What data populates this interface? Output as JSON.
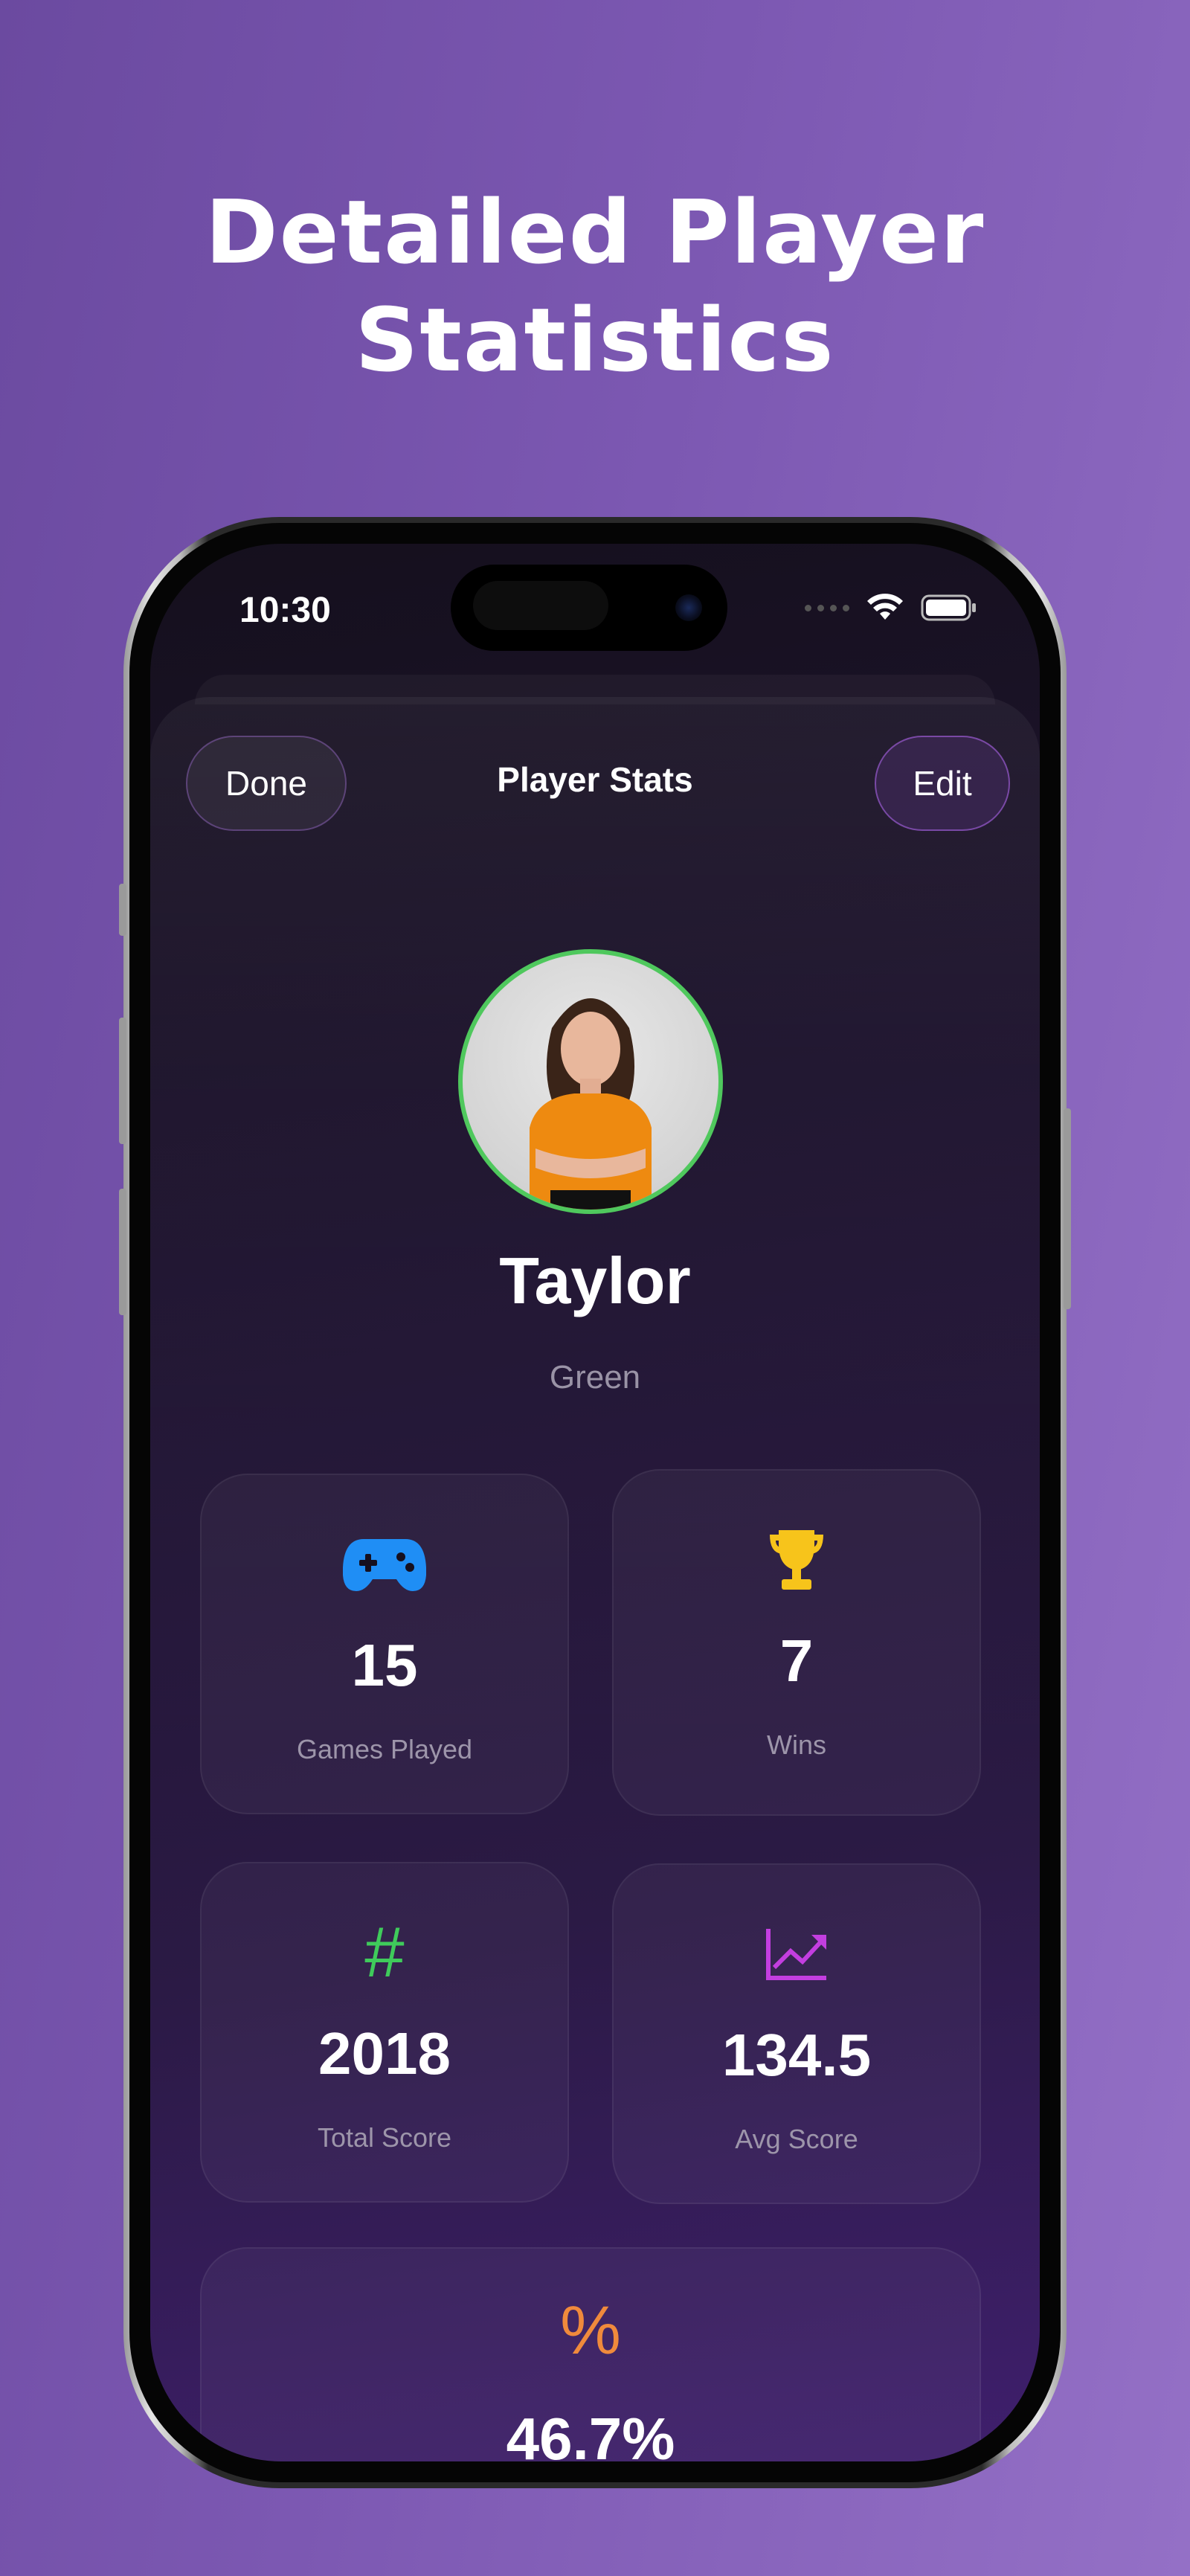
{
  "headline": {
    "line1": "Detailed Player",
    "line2": "Statistics"
  },
  "status_bar": {
    "time": "10:30"
  },
  "nav": {
    "done": "Done",
    "title": "Player Stats",
    "edit": "Edit"
  },
  "player": {
    "name": "Taylor",
    "color": "Green",
    "avatar_ring_color": "#4fc85d"
  },
  "stats": [
    {
      "icon": "gamepad-icon",
      "value": "15",
      "label": "Games Played",
      "color": "#1f8ef5"
    },
    {
      "icon": "trophy-icon",
      "value": "7",
      "label": "Wins",
      "color": "#f7c41b"
    },
    {
      "icon": "hashtag-icon",
      "value": "2018",
      "label": "Total Score",
      "color": "#3fcb5b"
    },
    {
      "icon": "chart-trend-icon",
      "value": "134.5",
      "label": "Avg Score",
      "color": "#c33ee0"
    },
    {
      "icon": "percent-icon",
      "value": "46.7%",
      "color": "#f08a3c"
    }
  ]
}
